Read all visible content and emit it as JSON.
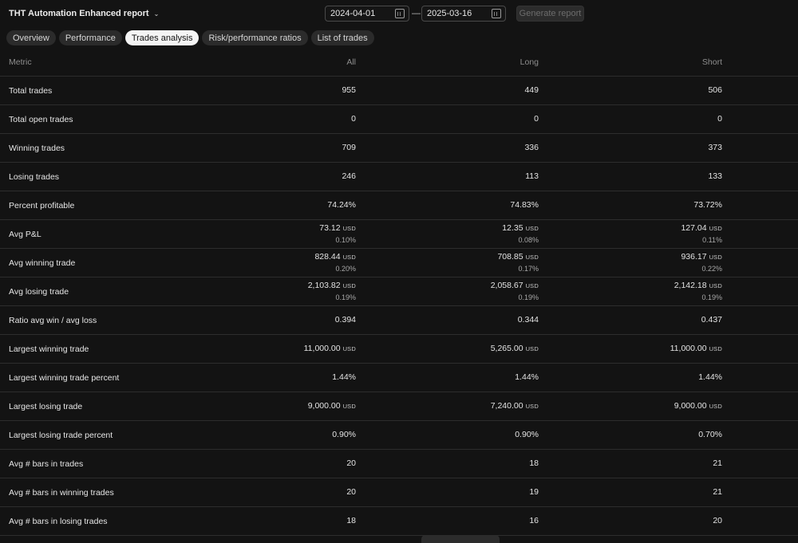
{
  "header": {
    "report_title": "THT Automation Enhanced report",
    "date_from": "2024-04-01",
    "date_separator": "—",
    "date_to": "2025-03-16",
    "generate_label": "Generate report"
  },
  "tabs": [
    {
      "label": "Overview"
    },
    {
      "label": "Performance"
    },
    {
      "label": "Trades analysis"
    },
    {
      "label": "Risk/performance ratios"
    },
    {
      "label": "List of trades"
    }
  ],
  "active_tab": "Trades analysis",
  "columns": {
    "metric": "Metric",
    "all": "All",
    "long": "Long",
    "short": "Short"
  },
  "rows": [
    {
      "metric": "Total trades",
      "all": {
        "main": "955"
      },
      "long": {
        "main": "449"
      },
      "short": {
        "main": "506"
      }
    },
    {
      "metric": "Total open trades",
      "all": {
        "main": "0"
      },
      "long": {
        "main": "0"
      },
      "short": {
        "main": "0"
      }
    },
    {
      "metric": "Winning trades",
      "all": {
        "main": "709"
      },
      "long": {
        "main": "336"
      },
      "short": {
        "main": "373"
      }
    },
    {
      "metric": "Losing trades",
      "all": {
        "main": "246"
      },
      "long": {
        "main": "113"
      },
      "short": {
        "main": "133"
      }
    },
    {
      "metric": "Percent profitable",
      "all": {
        "main": "74.24%"
      },
      "long": {
        "main": "74.83%"
      },
      "short": {
        "main": "73.72%"
      }
    },
    {
      "metric": "Avg P&L",
      "all": {
        "main": "73.12",
        "unit": "USD",
        "sub": "0.10%"
      },
      "long": {
        "main": "12.35",
        "unit": "USD",
        "sub": "0.08%"
      },
      "short": {
        "main": "127.04",
        "unit": "USD",
        "sub": "0.11%"
      }
    },
    {
      "metric": "Avg winning trade",
      "all": {
        "main": "828.44",
        "unit": "USD",
        "sub": "0.20%"
      },
      "long": {
        "main": "708.85",
        "unit": "USD",
        "sub": "0.17%"
      },
      "short": {
        "main": "936.17",
        "unit": "USD",
        "sub": "0.22%"
      }
    },
    {
      "metric": "Avg losing trade",
      "all": {
        "main": "2,103.82",
        "unit": "USD",
        "sub": "0.19%"
      },
      "long": {
        "main": "2,058.67",
        "unit": "USD",
        "sub": "0.19%"
      },
      "short": {
        "main": "2,142.18",
        "unit": "USD",
        "sub": "0.19%"
      }
    },
    {
      "metric": "Ratio avg win / avg loss",
      "all": {
        "main": "0.394"
      },
      "long": {
        "main": "0.344"
      },
      "short": {
        "main": "0.437"
      }
    },
    {
      "metric": "Largest winning trade",
      "all": {
        "main": "11,000.00",
        "unit": "USD"
      },
      "long": {
        "main": "5,265.00",
        "unit": "USD"
      },
      "short": {
        "main": "11,000.00",
        "unit": "USD"
      }
    },
    {
      "metric": "Largest winning trade percent",
      "all": {
        "main": "1.44%"
      },
      "long": {
        "main": "1.44%"
      },
      "short": {
        "main": "1.44%"
      }
    },
    {
      "metric": "Largest losing trade",
      "all": {
        "main": "9,000.00",
        "unit": "USD"
      },
      "long": {
        "main": "7,240.00",
        "unit": "USD"
      },
      "short": {
        "main": "9,000.00",
        "unit": "USD"
      }
    },
    {
      "metric": "Largest losing trade percent",
      "all": {
        "main": "0.90%"
      },
      "long": {
        "main": "0.90%"
      },
      "short": {
        "main": "0.70%"
      }
    },
    {
      "metric": "Avg # bars in trades",
      "all": {
        "main": "20"
      },
      "long": {
        "main": "18"
      },
      "short": {
        "main": "21"
      }
    },
    {
      "metric": "Avg # bars in winning trades",
      "all": {
        "main": "20"
      },
      "long": {
        "main": "19"
      },
      "short": {
        "main": "21"
      }
    },
    {
      "metric": "Avg # bars in losing trades",
      "all": {
        "main": "18"
      },
      "long": {
        "main": "16"
      },
      "short": {
        "main": "20"
      }
    }
  ],
  "icons": {
    "title_dropdown": "chevron-down-icon",
    "date_picker": "calendar-icon"
  },
  "colors": {
    "background": "#131313",
    "active_tab_bg": "#f4f4f4",
    "divider": "#2d2d2d"
  }
}
